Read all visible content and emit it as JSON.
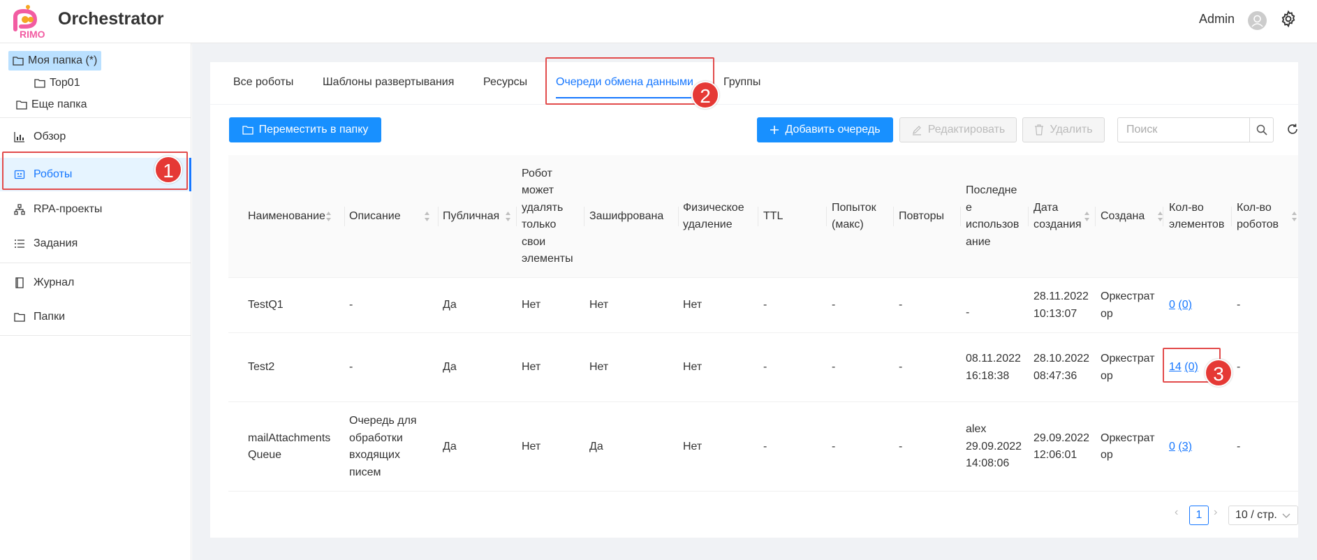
{
  "header": {
    "app_title": "Orchestrator",
    "logo_text": "RIMO",
    "user_name": "Admin"
  },
  "sidebar": {
    "folders": [
      {
        "label": "Моя папка (*)",
        "selected": true
      },
      {
        "label": "Top01",
        "selected": false
      },
      {
        "label": "Еще папка",
        "selected": false
      }
    ],
    "nav": [
      {
        "label": "Обзор",
        "icon": "bar-chart-icon"
      },
      {
        "label": "Роботы",
        "icon": "robot-icon",
        "active": true
      },
      {
        "label": "RPA-проекты",
        "icon": "hierarchy-icon"
      },
      {
        "label": "Задания",
        "icon": "list-icon"
      },
      {
        "label": "Журнал",
        "icon": "book-icon"
      },
      {
        "label": "Папки",
        "icon": "folder-icon"
      }
    ]
  },
  "tabs": [
    {
      "label": "Все роботы"
    },
    {
      "label": "Шаблоны развертывания"
    },
    {
      "label": "Ресурсы"
    },
    {
      "label": "Очереди обмена данными",
      "active": true
    },
    {
      "label": "Группы"
    }
  ],
  "toolbar": {
    "move_label": "Переместить в папку",
    "add_label": "Добавить очередь",
    "edit_label": "Редактировать",
    "delete_label": "Удалить",
    "search_placeholder": "Поиск"
  },
  "table": {
    "columns": [
      [
        "Наименование"
      ],
      [
        "Описание"
      ],
      [
        "Публичная"
      ],
      [
        "Робот",
        "может",
        "удалять",
        "только",
        "свои",
        "элементы"
      ],
      [
        "Зашифрована"
      ],
      [
        "Физическое",
        "удаление"
      ],
      [
        "TTL"
      ],
      [
        "Попыток",
        "(макс)"
      ],
      [
        "Повторы"
      ],
      [
        "Последне",
        "е",
        "использов",
        "ание"
      ],
      [
        "Дата",
        "создания"
      ],
      [
        "Создана"
      ],
      [
        "Кол-во",
        "элементов"
      ],
      [
        "Кол-во",
        "роботов"
      ]
    ],
    "rows": [
      {
        "name": [
          "TestQ1"
        ],
        "description": [
          "-"
        ],
        "public": "Да",
        "own_only": "Нет",
        "encrypted": "Нет",
        "physical": "Нет",
        "ttl": "-",
        "attempts": "-",
        "retries": "-",
        "last_used": [
          "-"
        ],
        "created_date": [
          "28.11.2022",
          "10:13:07"
        ],
        "created_by": [
          "Оркестрат",
          "ор"
        ],
        "items_main": "0",
        "items_sub": "(0)",
        "robots": "-"
      },
      {
        "name": [
          "Test2"
        ],
        "description": [
          "-"
        ],
        "public": "Да",
        "own_only": "Нет",
        "encrypted": "Нет",
        "physical": "Нет",
        "ttl": "-",
        "attempts": "-",
        "retries": "-",
        "last_used": [
          "08.11.2022",
          "16:18:38"
        ],
        "created_date": [
          "28.10.2022",
          "08:47:36"
        ],
        "created_by": [
          "Оркестрат",
          "ор"
        ],
        "items_main": "14",
        "items_sub": "(0)",
        "robots": "-"
      },
      {
        "name": [
          "mailAttachments",
          "Queue"
        ],
        "description": [
          "Очередь для",
          "обработки",
          "входящих",
          "писем"
        ],
        "public": "Да",
        "own_only": "Нет",
        "encrypted": "Да",
        "physical": "Нет",
        "ttl": "-",
        "attempts": "-",
        "retries": "-",
        "last_used": [
          "alex",
          "29.09.2022",
          "14:08:06"
        ],
        "created_date": [
          "29.09.2022",
          "12:06:01"
        ],
        "created_by": [
          "Оркестрат",
          "ор"
        ],
        "items_main": "0",
        "items_sub": "(3)",
        "robots": "-"
      }
    ]
  },
  "pagination": {
    "current": "1",
    "page_size": "10 / стр."
  },
  "callouts": [
    "1",
    "2",
    "3"
  ]
}
